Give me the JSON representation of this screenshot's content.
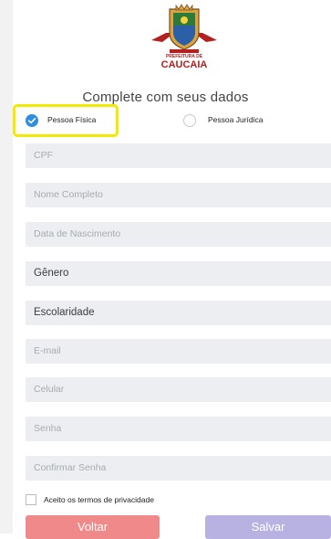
{
  "logo": {
    "line1": "PREFEITURA DE",
    "line2": "CAUCAIA"
  },
  "heading": "Complete com seus dados",
  "person_type": {
    "options": [
      {
        "label": "Pessoa Física",
        "selected": true
      },
      {
        "label": "Pessoa Jurídica",
        "selected": false
      }
    ]
  },
  "fields": {
    "cpf": "CPF",
    "nome": "Nome Completo",
    "nascimento": "Data de Nascimento",
    "genero": "Gênero",
    "escolaridade": "Escolaridade",
    "email": "E-mail",
    "celular": "Celular",
    "senha": "Senha",
    "confirmar": "Confirmar Senha"
  },
  "terms": {
    "label": "Aceito os termos de privacidade",
    "checked": false
  },
  "buttons": {
    "back": "Voltar",
    "save": "Salvar"
  },
  "colors": {
    "selected_radio": "#2e8fe0",
    "highlight": "#f2ea00",
    "back_button": "#f08a8a",
    "save_button": "#b8b2e3"
  }
}
